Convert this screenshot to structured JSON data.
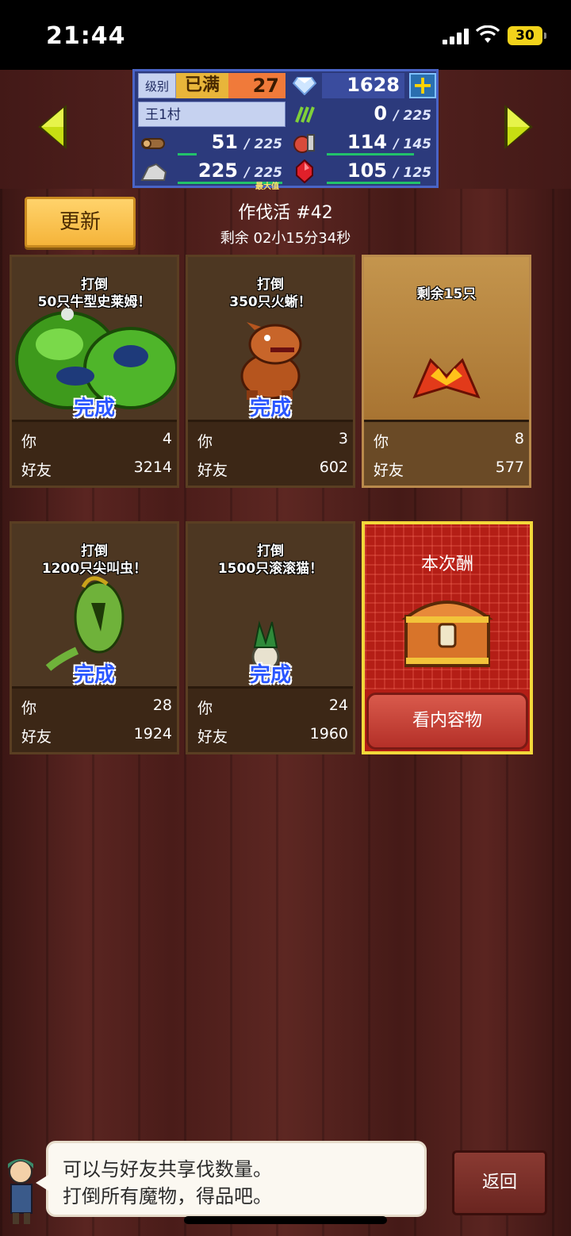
{
  "status_bar": {
    "time": "21:44",
    "battery": "30"
  },
  "stats": {
    "level_label": "级别",
    "level_status": "已满",
    "level_value": "27",
    "gems": "1628",
    "village_name": "王1村",
    "grass": {
      "value": "0",
      "cap": "/ 225"
    },
    "wood": {
      "value": "51",
      "cap": "/ 225"
    },
    "food": {
      "value": "114",
      "cap": "/ 145"
    },
    "ore": {
      "value": "225",
      "cap": "/ 225",
      "max_label": "最大值"
    },
    "mana": {
      "value": "105",
      "cap": "/ 125"
    }
  },
  "header": {
    "update_label": "更新",
    "event_title": "作伐活 #42",
    "remaining": "剩余 02小15分34秒"
  },
  "cards": [
    {
      "title_line1": "打倒",
      "title_line2": "50只牛型史莱姆！",
      "status": "完成",
      "you_label": "你",
      "you_value": "4",
      "friends_label": "好友",
      "friends_value": "3214"
    },
    {
      "title_line1": "打倒",
      "title_line2": "350只火蜥！",
      "status": "完成",
      "you_label": "你",
      "you_value": "3",
      "friends_label": "好友",
      "friends_value": "602"
    },
    {
      "title_line1": "剩余15只",
      "title_line2": "",
      "status": "",
      "you_label": "你",
      "you_value": "8",
      "friends_label": "好友",
      "friends_value": "577"
    },
    {
      "title_line1": "打倒",
      "title_line2": "1200只尖叫虫！",
      "status": "完成",
      "you_label": "你",
      "you_value": "28",
      "friends_label": "好友",
      "friends_value": "1924"
    },
    {
      "title_line1": "打倒",
      "title_line2": "1500只滚滚猫！",
      "status": "完成",
      "you_label": "你",
      "you_value": "24",
      "friends_label": "好友",
      "friends_value": "1960"
    }
  ],
  "reward": {
    "title": "本次酬",
    "button": "看内容物"
  },
  "dialog": {
    "line1": "可以与好友共享伐数量。",
    "line2": "打倒所有魔物，得品吧。"
  },
  "back_label": "返回",
  "icons": [
    "signal-icon",
    "wifi-icon",
    "diamond-icon",
    "plus-icon",
    "grass-icon",
    "wood-icon",
    "food-icon",
    "ore-icon",
    "ruby-icon",
    "chest-icon"
  ]
}
